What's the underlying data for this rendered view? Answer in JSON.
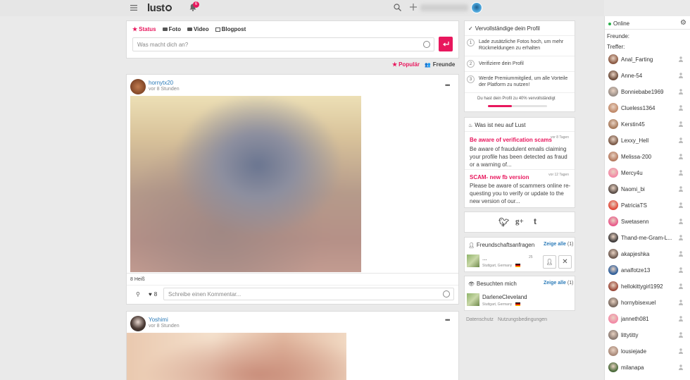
{
  "topbar": {
    "logo": "lust",
    "notifications_count": "6"
  },
  "composer": {
    "tabs": [
      "Status",
      "Foto",
      "Video",
      "Blogpost"
    ],
    "placeholder": "Was macht dich an?"
  },
  "filters": {
    "popular": "Populär",
    "friends": "Freunde"
  },
  "posts": [
    {
      "username": "hornytx20",
      "time": "vor 8 Stunden",
      "likes_summary": "8 Heiß",
      "like_count": "8",
      "comment_placeholder": "Schreibe einen Kommentar..."
    },
    {
      "username": "Yoshimi",
      "time": "vor 8 Stunden"
    }
  ],
  "profile_completion": {
    "title": "Vervollständige dein Profil",
    "steps": [
      {
        "num": "1",
        "text": "Lade zusätzliche Fotos hoch, um mehr Rückmeldungen zu erhalten"
      },
      {
        "num": "2",
        "text": "Verifiziere dein Profil"
      },
      {
        "num": "3",
        "text": "Werde Premiummitglied, um alle Vorteile der Platform zu nutzen!"
      }
    ],
    "progress_text": "Du hast dein Profil zu 40% vervollständigt",
    "progress": 0.4
  },
  "news": {
    "title": "Was ist neu auf Lust",
    "items": [
      {
        "title": "Be aware of verification scams",
        "age": "vor 8 Tagen",
        "text": "Be aware of fraudulent emails claiming your profile has been detected as fraud or a warning of..."
      },
      {
        "title": "SCAM- new fb version",
        "age": "vor 12 Tagen",
        "text": "Please be aware of scammers online re-questing you to verify or update to the new version of our..."
      }
    ]
  },
  "friend_requests": {
    "title": "Freundschaftsanfragen",
    "show_all": "Zeige alle",
    "count": "(1)",
    "user": {
      "name": "...",
      "age": "25",
      "location": "Stuttgart, Germany"
    }
  },
  "visitors": {
    "title": "Besuchten mich",
    "show_all": "Zeige alle",
    "count": "(1)",
    "user": {
      "name": "DarleneCleveland",
      "location": "Stuttgart, Germany"
    }
  },
  "footer": {
    "privacy": "Datenschutz",
    "terms": "Nutzungsbedingungen"
  },
  "online_panel": {
    "title": "Online",
    "friends_label": "Freunde:",
    "matches_label": "Treffer:",
    "users": [
      "Anal_Farting",
      "Anne-54",
      "Bonniebabe1969",
      "Clueless1364",
      "Kerstin45",
      "Lexxy_Hell",
      "Melissa-200",
      "Mercy4u",
      "Naomi_bi",
      "PatriciaTS",
      "Swetasenn",
      "Thand-me-Gram-L...",
      "akapjeshka",
      "analfotze13",
      "hellokittygirl1992",
      "hornybisexuel",
      "janneth081",
      "littytitty",
      "lousiejade",
      "milanapa"
    ]
  },
  "colors": {
    "accent": "#e8175d",
    "link": "#2a7ab8",
    "online": "#2ab04a"
  }
}
